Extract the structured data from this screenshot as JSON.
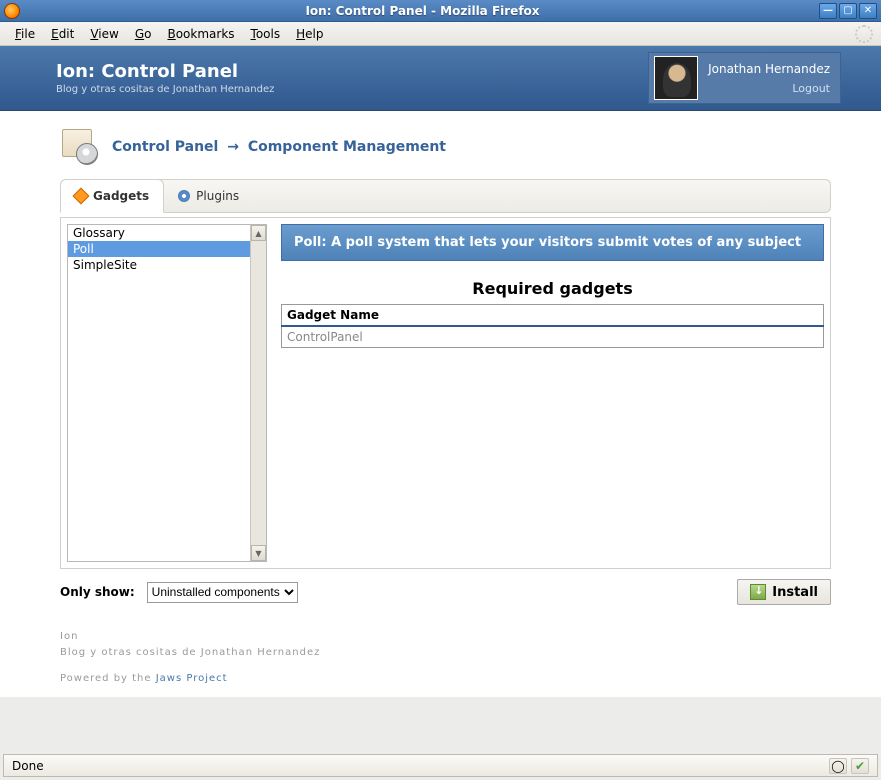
{
  "window": {
    "title": "Ion: Control Panel - Mozilla Firefox"
  },
  "menu": {
    "items": [
      "File",
      "Edit",
      "View",
      "Go",
      "Bookmarks",
      "Tools",
      "Help"
    ]
  },
  "header": {
    "title": "Ion: Control Panel",
    "subtitle": "Blog y otras cositas de Jonathan Hernandez",
    "user_name": "Jonathan Hernandez",
    "logout_label": "Logout"
  },
  "breadcrumb": {
    "root": "Control Panel",
    "arrow": "→",
    "current": "Component Management"
  },
  "tabs": {
    "gadgets": "Gadgets",
    "plugins": "Plugins"
  },
  "listbox": {
    "items": [
      "Glossary",
      "Poll",
      "SimpleSite"
    ],
    "selected_index": 1
  },
  "detail": {
    "description": "Poll: A poll system that lets your visitors submit votes of any subject",
    "required_heading": "Required gadgets",
    "table_header": "Gadget Name",
    "rows": [
      "ControlPanel"
    ]
  },
  "controls": {
    "only_show_label": "Only show:",
    "filter_value": "Uninstalled components",
    "install_label": "Install"
  },
  "footer": {
    "line1": "Ion",
    "line2": "Blog y otras cositas de Jonathan Hernandez",
    "powered_prefix": "Powered by the ",
    "powered_link": "Jaws Project"
  },
  "statusbar": {
    "text": "Done"
  }
}
